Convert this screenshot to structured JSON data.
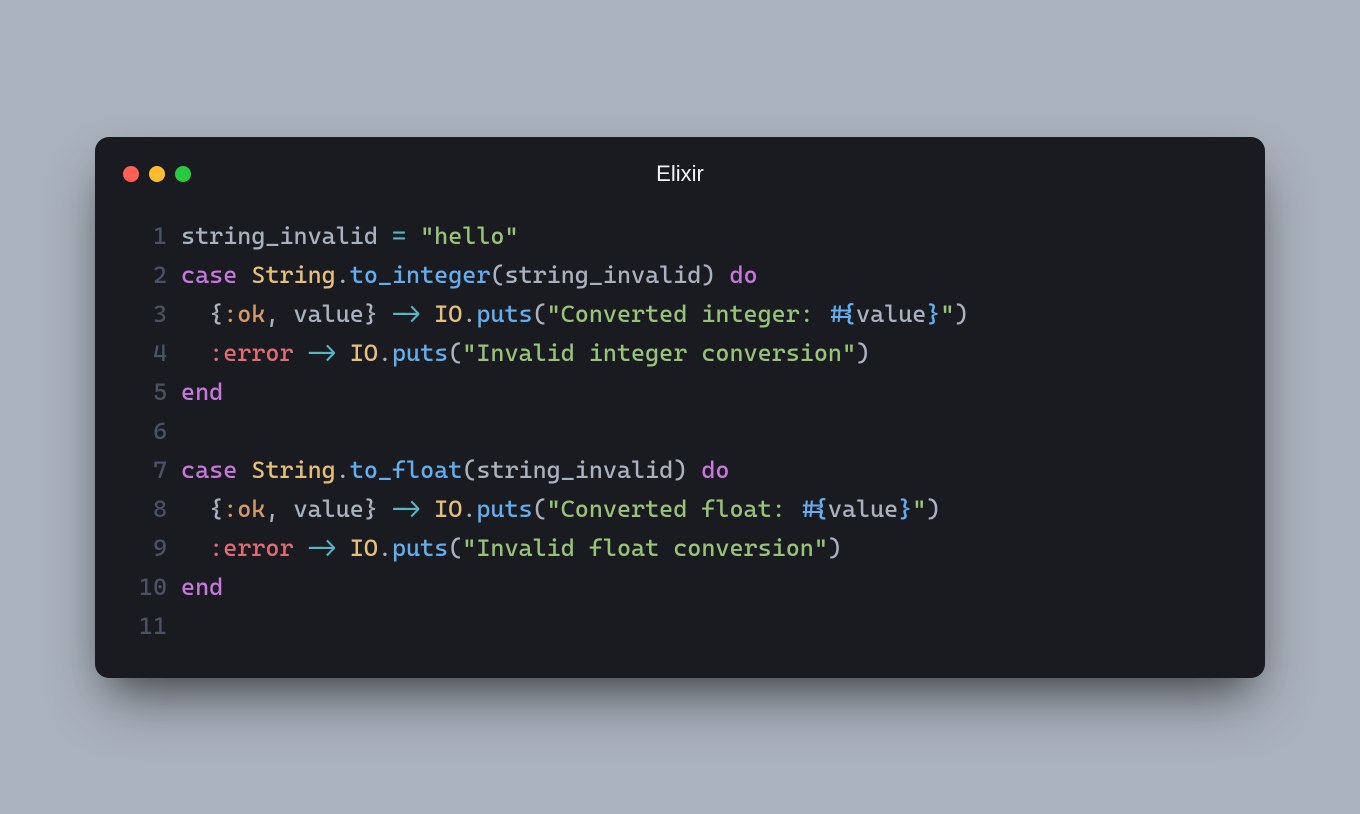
{
  "window": {
    "title": "Elixir"
  },
  "colors": {
    "background_page": "#aab2bd",
    "background_window": "#1a1b20",
    "traffic_red": "#ff5f56",
    "traffic_yellow": "#ffbd2e",
    "traffic_green": "#27c93f",
    "lineno": "#4b5263",
    "default": "#abb2bf",
    "keyword": "#c678dd",
    "module": "#e5c07b",
    "method": "#61afef",
    "string": "#98c379",
    "atom": "#d19a66",
    "error_atom": "#e06c75",
    "operator": "#56b6c2",
    "interpolation": "#61afef"
  },
  "code": {
    "language": "elixir",
    "lines": [
      {
        "n": 1,
        "tokens": [
          {
            "t": "string_invalid ",
            "c": "default"
          },
          {
            "t": "=",
            "c": "op"
          },
          {
            "t": " ",
            "c": "default"
          },
          {
            "t": "\"hello\"",
            "c": "string"
          }
        ]
      },
      {
        "n": 2,
        "tokens": [
          {
            "t": "case",
            "c": "keyword"
          },
          {
            "t": " ",
            "c": "default"
          },
          {
            "t": "String",
            "c": "module"
          },
          {
            "t": ".",
            "c": "punct"
          },
          {
            "t": "to_integer",
            "c": "method"
          },
          {
            "t": "(",
            "c": "punct"
          },
          {
            "t": "string_invalid",
            "c": "default"
          },
          {
            "t": ")",
            "c": "punct"
          },
          {
            "t": " ",
            "c": "default"
          },
          {
            "t": "do",
            "c": "keyword"
          }
        ]
      },
      {
        "n": 3,
        "tokens": [
          {
            "t": "  ",
            "c": "default"
          },
          {
            "t": "{",
            "c": "punct"
          },
          {
            "t": ":ok",
            "c": "atom"
          },
          {
            "t": ",",
            "c": "punct"
          },
          {
            "t": " value",
            "c": "default"
          },
          {
            "t": "}",
            "c": "punct"
          },
          {
            "t": " ",
            "c": "default"
          },
          {
            "t": "->",
            "c": "op"
          },
          {
            "t": " ",
            "c": "default"
          },
          {
            "t": "IO",
            "c": "module"
          },
          {
            "t": ".",
            "c": "punct"
          },
          {
            "t": "puts",
            "c": "method"
          },
          {
            "t": "(",
            "c": "punct"
          },
          {
            "t": "\"Converted integer: ",
            "c": "string"
          },
          {
            "t": "#{",
            "c": "interp"
          },
          {
            "t": "value",
            "c": "default"
          },
          {
            "t": "}",
            "c": "interp"
          },
          {
            "t": "\"",
            "c": "string"
          },
          {
            "t": ")",
            "c": "punct"
          }
        ]
      },
      {
        "n": 4,
        "tokens": [
          {
            "t": "  ",
            "c": "default"
          },
          {
            "t": ":error",
            "c": "error"
          },
          {
            "t": " ",
            "c": "default"
          },
          {
            "t": "->",
            "c": "op"
          },
          {
            "t": " ",
            "c": "default"
          },
          {
            "t": "IO",
            "c": "module"
          },
          {
            "t": ".",
            "c": "punct"
          },
          {
            "t": "puts",
            "c": "method"
          },
          {
            "t": "(",
            "c": "punct"
          },
          {
            "t": "\"Invalid integer conversion\"",
            "c": "string"
          },
          {
            "t": ")",
            "c": "punct"
          }
        ]
      },
      {
        "n": 5,
        "tokens": [
          {
            "t": "end",
            "c": "keyword"
          }
        ]
      },
      {
        "n": 6,
        "tokens": [
          {
            "t": "",
            "c": "default"
          }
        ]
      },
      {
        "n": 7,
        "tokens": [
          {
            "t": "case",
            "c": "keyword"
          },
          {
            "t": " ",
            "c": "default"
          },
          {
            "t": "String",
            "c": "module"
          },
          {
            "t": ".",
            "c": "punct"
          },
          {
            "t": "to_float",
            "c": "method"
          },
          {
            "t": "(",
            "c": "punct"
          },
          {
            "t": "string_invalid",
            "c": "default"
          },
          {
            "t": ")",
            "c": "punct"
          },
          {
            "t": " ",
            "c": "default"
          },
          {
            "t": "do",
            "c": "keyword"
          }
        ]
      },
      {
        "n": 8,
        "tokens": [
          {
            "t": "  ",
            "c": "default"
          },
          {
            "t": "{",
            "c": "punct"
          },
          {
            "t": ":ok",
            "c": "atom"
          },
          {
            "t": ",",
            "c": "punct"
          },
          {
            "t": " value",
            "c": "default"
          },
          {
            "t": "}",
            "c": "punct"
          },
          {
            "t": " ",
            "c": "default"
          },
          {
            "t": "->",
            "c": "op"
          },
          {
            "t": " ",
            "c": "default"
          },
          {
            "t": "IO",
            "c": "module"
          },
          {
            "t": ".",
            "c": "punct"
          },
          {
            "t": "puts",
            "c": "method"
          },
          {
            "t": "(",
            "c": "punct"
          },
          {
            "t": "\"Converted float: ",
            "c": "string"
          },
          {
            "t": "#{",
            "c": "interp"
          },
          {
            "t": "value",
            "c": "default"
          },
          {
            "t": "}",
            "c": "interp"
          },
          {
            "t": "\"",
            "c": "string"
          },
          {
            "t": ")",
            "c": "punct"
          }
        ]
      },
      {
        "n": 9,
        "tokens": [
          {
            "t": "  ",
            "c": "default"
          },
          {
            "t": ":error",
            "c": "error"
          },
          {
            "t": " ",
            "c": "default"
          },
          {
            "t": "->",
            "c": "op"
          },
          {
            "t": " ",
            "c": "default"
          },
          {
            "t": "IO",
            "c": "module"
          },
          {
            "t": ".",
            "c": "punct"
          },
          {
            "t": "puts",
            "c": "method"
          },
          {
            "t": "(",
            "c": "punct"
          },
          {
            "t": "\"Invalid float conversion\"",
            "c": "string"
          },
          {
            "t": ")",
            "c": "punct"
          }
        ]
      },
      {
        "n": 10,
        "tokens": [
          {
            "t": "end",
            "c": "keyword"
          }
        ]
      },
      {
        "n": 11,
        "tokens": [
          {
            "t": "",
            "c": "default"
          }
        ]
      }
    ]
  }
}
